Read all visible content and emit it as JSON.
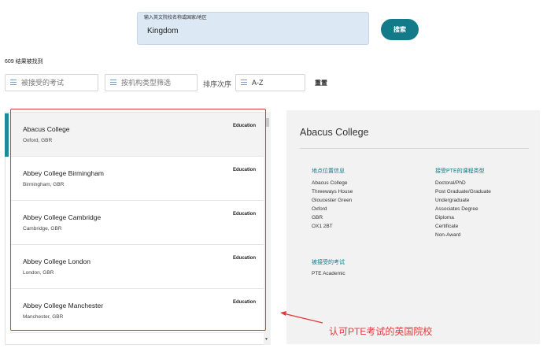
{
  "search": {
    "label": "输入英文院校名称或国家/地区",
    "value": "Kingdom",
    "button_label": "搜索"
  },
  "results_count": "609 结果被找到",
  "filters": {
    "exam_placeholder": "被接受的考试",
    "type_placeholder": "按机构类型筛选",
    "sort_label": "排序次序",
    "sort_value": "A-Z",
    "reset_label": "重置"
  },
  "results": [
    {
      "name": "Abacus College",
      "location": "Oxford, GBR",
      "type": "Education"
    },
    {
      "name": "Abbey College Birmingham",
      "location": "Birmingham, GBR",
      "type": "Education"
    },
    {
      "name": "Abbey College Cambridge",
      "location": "Cambridge, GBR",
      "type": "Education"
    },
    {
      "name": "Abbey College London",
      "location": "London, GBR",
      "type": "Education"
    },
    {
      "name": "Abbey College Manchester",
      "location": "Manchester, GBR",
      "type": "Education"
    }
  ],
  "detail": {
    "title": "Abacus College",
    "location_heading": "地点位置信息",
    "address": [
      "Abacus College",
      "Threeways House",
      "Gloucester Green",
      "Oxford",
      "GBR",
      "OX1 2BT"
    ],
    "programs_heading": "接受PTE的课程类型",
    "programs": [
      "Doctoral/PhD",
      "Post Graduate/Graduate",
      "Undergraduate",
      "Associates Degree",
      "Diploma",
      "Certificate",
      "Non-Award"
    ],
    "exams_heading": "被接受的考试",
    "exams": [
      "PTE Academic"
    ]
  },
  "annotation": "认可PTE考试的英国院校",
  "colors": {
    "accent": "#137a8a",
    "highlight": "#e23a3a"
  }
}
